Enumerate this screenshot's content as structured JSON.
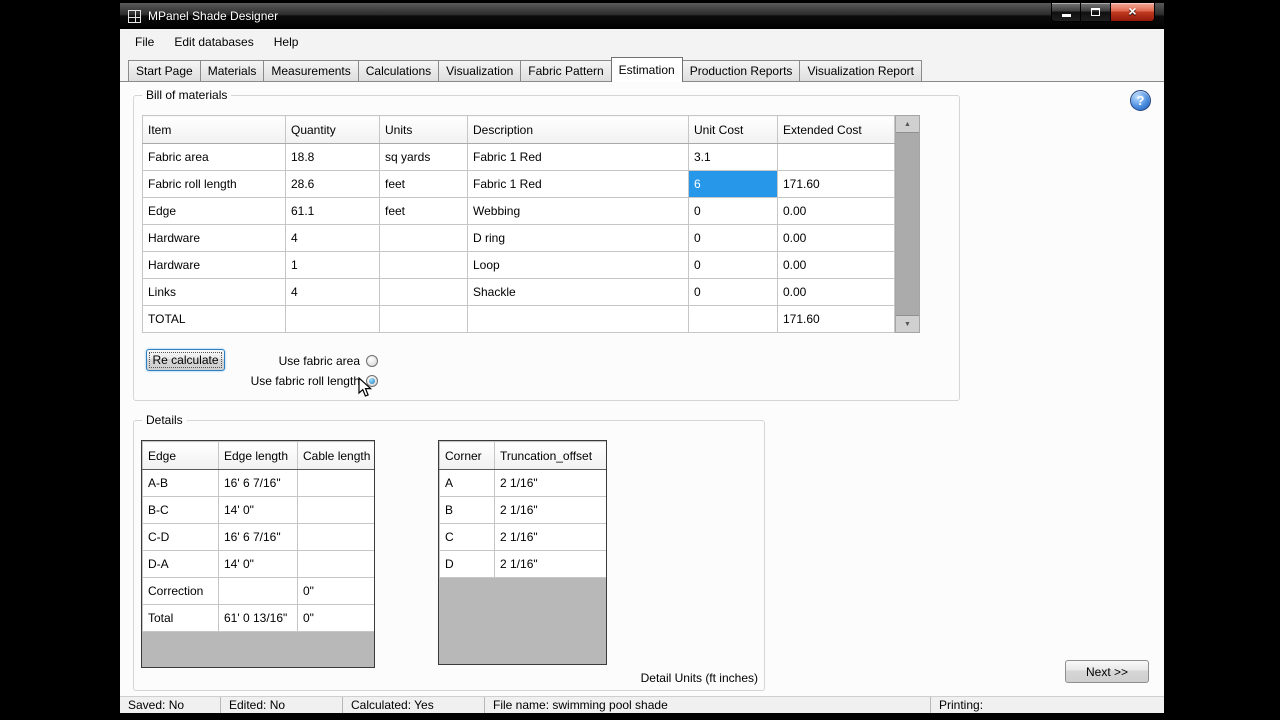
{
  "window": {
    "title": "MPanel Shade Designer"
  },
  "menu": {
    "items": [
      {
        "name": "file",
        "label": "File"
      },
      {
        "name": "edit-databases",
        "label": "Edit databases"
      },
      {
        "name": "help",
        "label": "Help"
      }
    ]
  },
  "tabs": [
    {
      "name": "start-page",
      "label": "Start Page",
      "active": false
    },
    {
      "name": "materials",
      "label": "Materials",
      "active": false
    },
    {
      "name": "measurements",
      "label": "Measurements",
      "active": false
    },
    {
      "name": "calculations",
      "label": "Calculations",
      "active": false
    },
    {
      "name": "visualization",
      "label": "Visualization",
      "active": false
    },
    {
      "name": "fabric-pattern",
      "label": "Fabric Pattern",
      "active": false
    },
    {
      "name": "estimation",
      "label": "Estimation",
      "active": true
    },
    {
      "name": "production-reports",
      "label": "Production Reports",
      "active": false
    },
    {
      "name": "visualization-report",
      "label": "Visualization Report",
      "active": false
    }
  ],
  "help_label": "?",
  "bill_of_materials": {
    "label": "Bill of materials",
    "columns": [
      "Item",
      "Quantity",
      "Units",
      "Description",
      "Unit Cost",
      "Extended Cost"
    ],
    "rows": [
      [
        "Fabric area",
        "18.8",
        "sq yards",
        "Fabric 1 Red",
        "3.1",
        ""
      ],
      [
        "Fabric roll length",
        "28.6",
        "feet",
        "Fabric 1 Red",
        "6",
        "171.60"
      ],
      [
        "Edge",
        "61.1",
        "feet",
        "Webbing",
        "0",
        "0.00"
      ],
      [
        "Hardware",
        "4",
        "",
        "D ring",
        "0",
        "0.00"
      ],
      [
        "Hardware",
        "1",
        "",
        "Loop",
        "0",
        "0.00"
      ],
      [
        "Links",
        "4",
        "",
        "Shackle",
        "0",
        "0.00"
      ],
      [
        "TOTAL",
        "",
        "",
        "",
        "",
        "171.60"
      ]
    ],
    "selected_cell": {
      "row": 1,
      "col": 4,
      "value": "6"
    },
    "recalculate_label": "Re calculate",
    "radios": [
      {
        "label": "Use fabric area",
        "checked": false
      },
      {
        "label": "Use fabric roll length",
        "checked": true
      }
    ]
  },
  "details": {
    "label": "Details",
    "edge_table": {
      "columns": [
        "Edge",
        "Edge length",
        "Cable length"
      ],
      "rows": [
        [
          "A-B",
          "16' 6 7/16\"",
          ""
        ],
        [
          "B-C",
          "14' 0\"",
          ""
        ],
        [
          "C-D",
          "16' 6 7/16\"",
          ""
        ],
        [
          "D-A",
          "14' 0\"",
          ""
        ],
        [
          "Correction",
          "",
          "0\""
        ],
        [
          "Total",
          "61' 0 13/16\"",
          "0\""
        ]
      ]
    },
    "corner_table": {
      "columns": [
        "Corner",
        "Truncation_offset"
      ],
      "rows": [
        [
          "A",
          "2 1/16\""
        ],
        [
          "B",
          "2 1/16\""
        ],
        [
          "C",
          "2 1/16\""
        ],
        [
          "D",
          "2 1/16\""
        ]
      ]
    },
    "units_note": "Detail Units (ft inches)"
  },
  "next_label": "Next >>",
  "statusbar": {
    "saved": "Saved: No",
    "edited": "Edited: No",
    "calculated": "Calculated: Yes",
    "file_name": "File name: swimming pool shade",
    "printing": "Printing:"
  },
  "colors": {
    "selected_cell": "#2797ea",
    "close_button_red": "#c03a20",
    "help_button_blue": "#1a55b0"
  }
}
